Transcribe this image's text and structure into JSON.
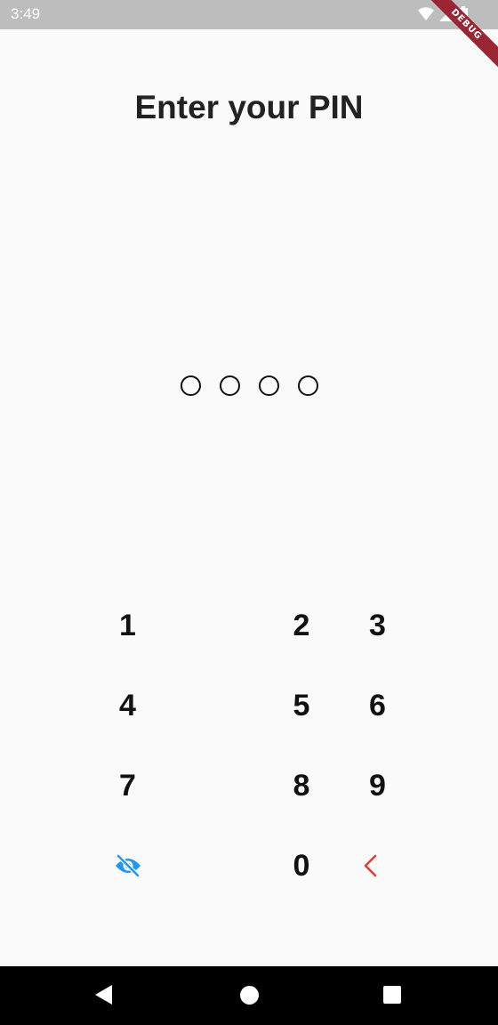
{
  "status_bar": {
    "time": "3:49",
    "icons": [
      "wifi-icon",
      "signal-icon",
      "battery-icon"
    ],
    "background": "#bdbdbd"
  },
  "debug_banner": {
    "label": "DEBUG",
    "color": "#9b2532"
  },
  "screen": {
    "title": "Enter your PIN"
  },
  "pin": {
    "length": 4,
    "entered": 0
  },
  "keypad": {
    "rows": [
      [
        {
          "label": "1"
        },
        {
          "label": "2"
        },
        {
          "label": "3"
        }
      ],
      [
        {
          "label": "4"
        },
        {
          "label": "5"
        },
        {
          "label": "6"
        }
      ],
      [
        {
          "label": "7"
        },
        {
          "label": "8"
        },
        {
          "label": "9"
        }
      ],
      [
        {
          "icon": "eye-off-icon",
          "color": "#2196f3"
        },
        {
          "label": "0"
        },
        {
          "icon": "chevron-left-icon",
          "color": "#e53935"
        }
      ]
    ]
  },
  "nav_bar": {
    "icons": [
      "back-icon",
      "home-icon",
      "recent-apps-icon"
    ]
  }
}
